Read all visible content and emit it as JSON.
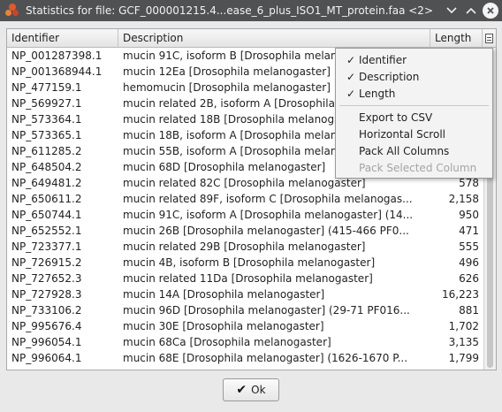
{
  "window": {
    "title": "Statistics for file: GCF_000001215.4...ease_6_plus_ISO1_MT_protein.faa <2>",
    "minimize_icon": "chevron-down-icon",
    "maximize_icon": "chevron-up-icon",
    "close_icon": "close-icon"
  },
  "table": {
    "headers": {
      "identifier": "Identifier",
      "description": "Description",
      "length": "Length"
    },
    "rows": [
      {
        "id": "NP_001287398.1",
        "desc": "mucin 91C, isoform B [Drosophila melanogaster]",
        "len": ""
      },
      {
        "id": "NP_001368944.1",
        "desc": "mucin 12Ea [Drosophila melanogaster]",
        "len": ""
      },
      {
        "id": "NP_477159.1",
        "desc": "hemomucin [Drosophila melanogaster]",
        "len": ""
      },
      {
        "id": "NP_569927.1",
        "desc": "mucin related 2B, isoform A [Drosophila melanogaster]",
        "len": ""
      },
      {
        "id": "NP_573364.1",
        "desc": "mucin related 18B [Drosophila melanogaster]",
        "len": ""
      },
      {
        "id": "NP_573365.1",
        "desc": "mucin 18B, isoform A [Drosophila melanogaster]",
        "len": ""
      },
      {
        "id": "NP_611285.2",
        "desc": "mucin 55B, isoform A [Drosophila melanogaster]",
        "len": ""
      },
      {
        "id": "NP_648504.2",
        "desc": "mucin 68D [Drosophila melanogaster]",
        "len": ""
      },
      {
        "id": "NP_649481.2",
        "desc": "mucin related 82C [Drosophila melanogaster]",
        "len": "578"
      },
      {
        "id": "NP_650611.2",
        "desc": "mucin related 89F, isoform C [Drosophila melanogas...",
        "len": "2,158"
      },
      {
        "id": "NP_650744.1",
        "desc": "mucin 91C, isoform A [Drosophila melanogaster] (14...",
        "len": "950"
      },
      {
        "id": "NP_652552.1",
        "desc": "mucin 26B [Drosophila melanogaster] (415-466 PF0...",
        "len": "471"
      },
      {
        "id": "NP_723377.1",
        "desc": "mucin related 29B [Drosophila melanogaster]",
        "len": "555"
      },
      {
        "id": "NP_726915.2",
        "desc": "mucin 4B, isoform B [Drosophila melanogaster]",
        "len": "496"
      },
      {
        "id": "NP_727652.3",
        "desc": "mucin related 11Da [Drosophila melanogaster]",
        "len": "626"
      },
      {
        "id": "NP_727928.3",
        "desc": "mucin 14A [Drosophila melanogaster]",
        "len": "16,223"
      },
      {
        "id": "NP_733106.2",
        "desc": "mucin 96D [Drosophila melanogaster] (29-71 PF016...",
        "len": "881"
      },
      {
        "id": "NP_995676.4",
        "desc": "mucin 30E [Drosophila melanogaster]",
        "len": "1,702"
      },
      {
        "id": "NP_996054.1",
        "desc": "mucin 68Ca [Drosophila melanogaster]",
        "len": "3,135"
      },
      {
        "id": "NP_996064.1",
        "desc": "mucin 68E [Drosophila melanogaster] (1626-1670 P...",
        "len": "1,799"
      }
    ]
  },
  "column_menu": {
    "check_glyph": "✓",
    "columns": [
      {
        "label": "Identifier",
        "checked": true
      },
      {
        "label": "Description",
        "checked": true
      },
      {
        "label": "Length",
        "checked": true
      }
    ],
    "actions": {
      "export_csv": "Export to CSV",
      "horizontal_scroll": "Horizontal Scroll",
      "pack_all": "Pack All Columns",
      "pack_selected": "Pack Selected Column"
    }
  },
  "footer": {
    "ok_label": "Ok",
    "ok_icon": "checkmark-icon"
  }
}
